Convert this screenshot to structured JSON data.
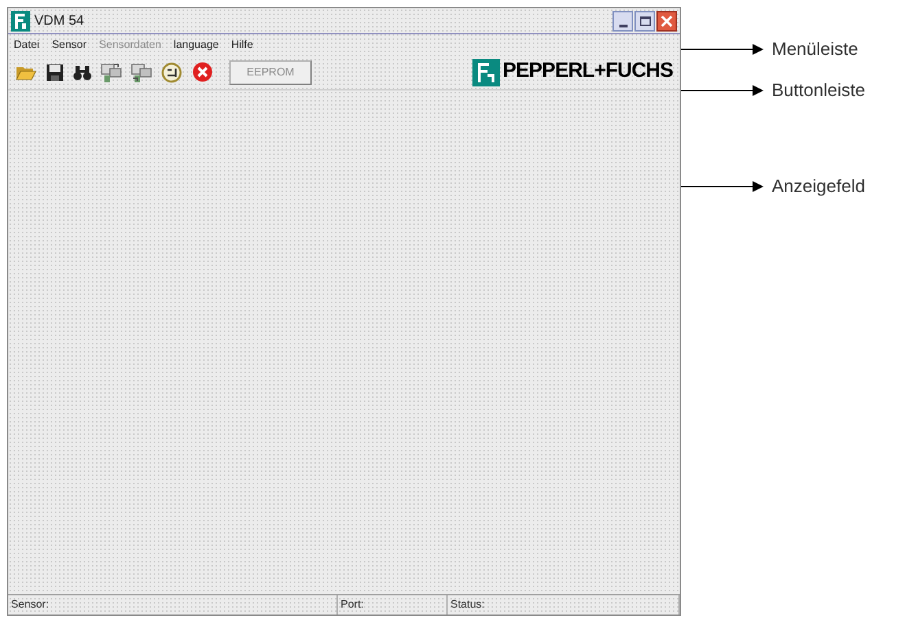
{
  "window": {
    "title": "VDM 54"
  },
  "menu": [
    {
      "label": "Datei",
      "disabled": false
    },
    {
      "label": "Sensor",
      "disabled": false
    },
    {
      "label": "Sensordaten",
      "disabled": true
    },
    {
      "label": "language",
      "disabled": false
    },
    {
      "label": "Hilfe",
      "disabled": false
    }
  ],
  "toolbar": [
    {
      "kind": "open"
    },
    {
      "kind": "save"
    },
    {
      "kind": "find"
    },
    {
      "kind": "upload"
    },
    {
      "kind": "download"
    },
    {
      "kind": "sensor"
    },
    {
      "kind": "stop"
    },
    {
      "kind": "button",
      "label": "EEPROM",
      "disabled": true
    }
  ],
  "logo": {
    "text": "PEPPERL+FUCHS"
  },
  "status_bar": [
    {
      "label": "Sensor:"
    },
    {
      "label": "Port:"
    },
    {
      "label": "Status:"
    }
  ],
  "callouts": [
    {
      "label": "Menüleiste"
    },
    {
      "label": "Buttonleiste"
    },
    {
      "label": "Anzeigefeld"
    }
  ]
}
